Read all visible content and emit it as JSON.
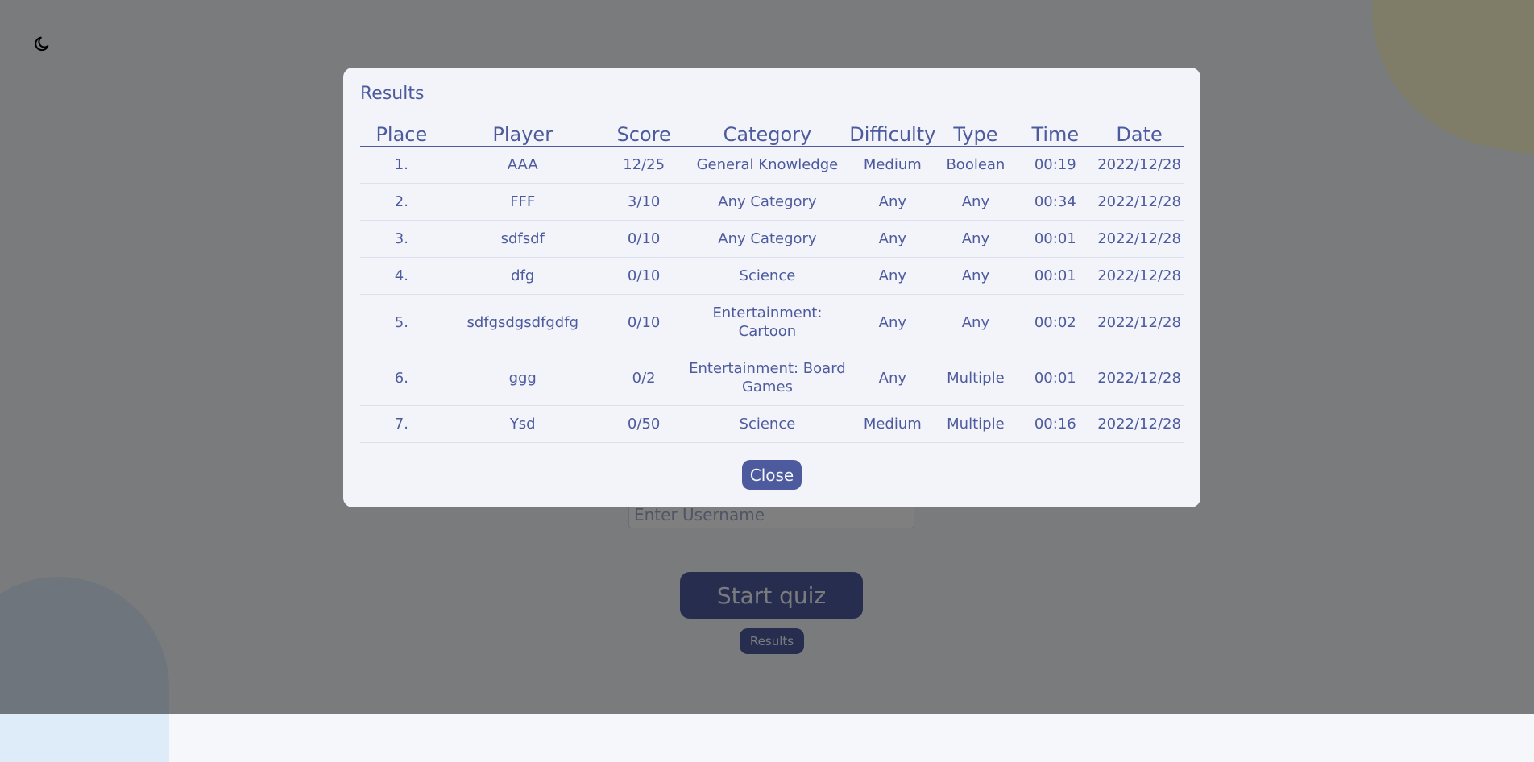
{
  "theme_toggle": {
    "icon": "moon-icon"
  },
  "start": {
    "username_placeholder": "Enter Username",
    "start_label": "Start quiz",
    "results_label": "Results"
  },
  "modal": {
    "title": "Results",
    "columns": [
      "Place",
      "Player",
      "Score",
      "Category",
      "Difficulty",
      "Type",
      "Time",
      "Date"
    ],
    "rows": [
      [
        "1.",
        "AAA",
        "12/25",
        "General Knowledge",
        "Medium",
        "Boolean",
        "00:19",
        "2022/12/28"
      ],
      [
        "2.",
        "FFF",
        "3/10",
        "Any Category",
        "Any",
        "Any",
        "00:34",
        "2022/12/28"
      ],
      [
        "3.",
        "sdfsdf",
        "0/10",
        "Any Category",
        "Any",
        "Any",
        "00:01",
        "2022/12/28"
      ],
      [
        "4.",
        "dfg",
        "0/10",
        "Science",
        "Any",
        "Any",
        "00:01",
        "2022/12/28"
      ],
      [
        "5.",
        "sdfgsdgsdfgdfg",
        "0/10",
        "Entertainment: Cartoon",
        "Any",
        "Any",
        "00:02",
        "2022/12/28"
      ],
      [
        "6.",
        "ggg",
        "0/2",
        "Entertainment: Board Games",
        "Any",
        "Multiple",
        "00:01",
        "2022/12/28"
      ],
      [
        "7.",
        "Ysd",
        "0/50",
        "Science",
        "Medium",
        "Multiple",
        "00:16",
        "2022/12/28"
      ]
    ],
    "close_label": "Close"
  },
  "colors": {
    "primary": "#4d5b9e",
    "background": "#f5f7fb",
    "blob_yellow": "#fffad1",
    "blob_blue": "#deebf8"
  }
}
